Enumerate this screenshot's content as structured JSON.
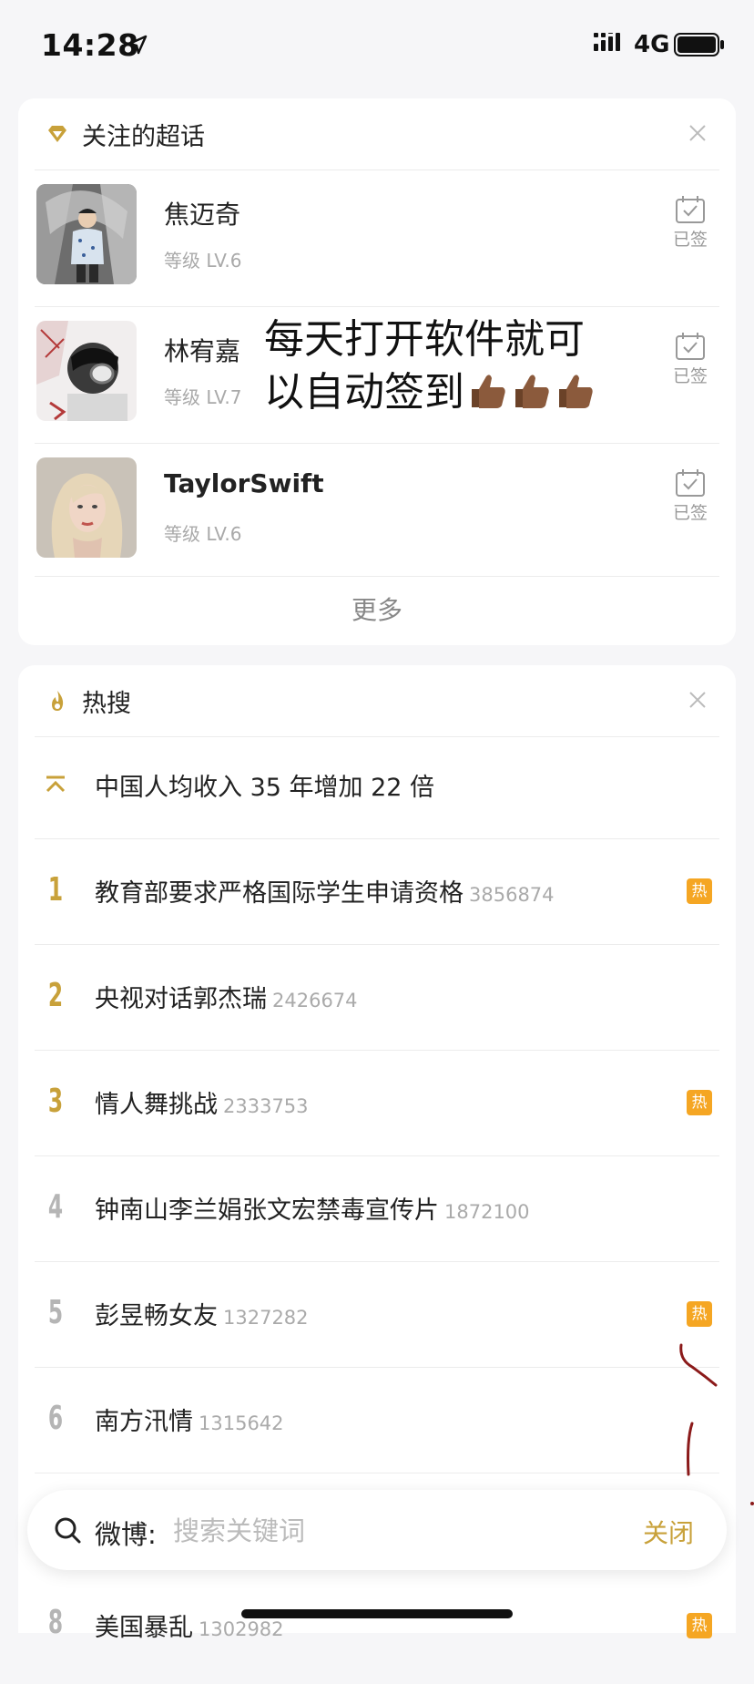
{
  "status": {
    "time": "14:28",
    "network": "4G"
  },
  "topics_card": {
    "title": "关注的超话",
    "items": [
      {
        "name": "焦迈奇",
        "level": "等级 LV.6",
        "status": "已签"
      },
      {
        "name": "林宥嘉",
        "level": "等级 LV.7",
        "status": "已签"
      },
      {
        "name": "TaylorSwift",
        "level": "等级 LV.6",
        "status": "已签"
      }
    ],
    "overlay_line1": "每天打开软件就可",
    "overlay_line2": "以自动签到",
    "more": "更多"
  },
  "hot_card": {
    "title": "热搜",
    "pinned": {
      "title": "中国人均收入 35 年增加 22 倍"
    },
    "items": [
      {
        "rank": "1",
        "title": "教育部要求严格国际学生申请资格",
        "count": "3856874",
        "badge": "热"
      },
      {
        "rank": "2",
        "title": "央视对话郭杰瑞",
        "count": "2426674",
        "badge": ""
      },
      {
        "rank": "3",
        "title": "情人舞挑战",
        "count": "2333753",
        "badge": "热"
      },
      {
        "rank": "4",
        "title": "钟南山李兰娟张文宏禁毒宣传片",
        "count": "1872100",
        "badge": ""
      },
      {
        "rank": "5",
        "title": "彭昱畅女友",
        "count": "1327282",
        "badge": "热"
      },
      {
        "rank": "6",
        "title": "南方汛情",
        "count": "1315642",
        "badge": ""
      }
    ],
    "partial_item": {
      "rank": "8",
      "title": "美国暴乱",
      "count": "1302982",
      "badge": "热"
    }
  },
  "search": {
    "prefix": "微博:",
    "placeholder": "搜索关键词",
    "close": "关闭"
  },
  "colors": {
    "accent": "#c8a13a",
    "badge": "#f5a623",
    "ink": "#8b1a1a"
  }
}
